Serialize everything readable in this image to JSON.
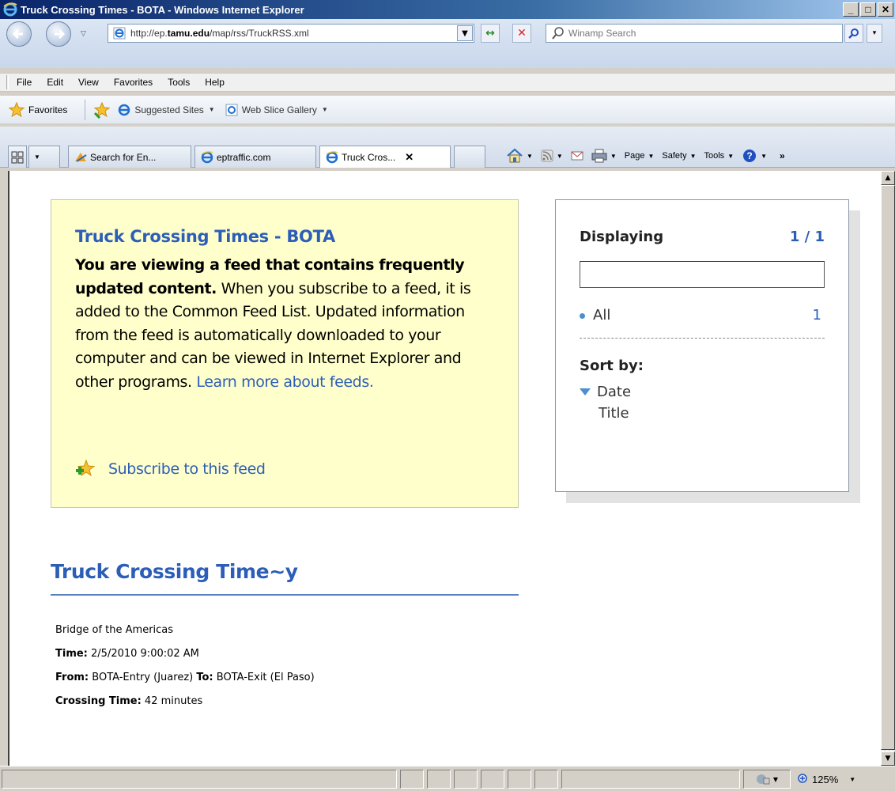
{
  "window": {
    "title": "Truck Crossing Times - BOTA - Windows Internet Explorer"
  },
  "address": {
    "url_prefix": "http://ep.",
    "url_domain": "tamu.edu",
    "url_suffix": "/map/rss/TruckRSS.xml"
  },
  "search": {
    "placeholder": "Winamp Search"
  },
  "menu": {
    "items": [
      "File",
      "Edit",
      "View",
      "Favorites",
      "Tools",
      "Help"
    ]
  },
  "favorites_bar": {
    "favorites": "Favorites",
    "suggested": "Suggested Sites",
    "webslice": "Web Slice Gallery"
  },
  "tabs": [
    {
      "label": "Search for En..."
    },
    {
      "label": "eptraffic.com"
    },
    {
      "label": "Truck Cros..."
    }
  ],
  "commands": {
    "page": "Page",
    "safety": "Safety",
    "tools": "Tools"
  },
  "infobox": {
    "title": "Truck Crossing Times - BOTA",
    "bold_text": "You are viewing a feed that contains frequently updated content.",
    "body_text": " When you subscribe to a feed, it is added to the Common Feed List. Updated information from the feed is automatically downloaded to your computer and can be viewed in Internet Explorer and other programs. ",
    "learn_more": "Learn more about feeds.",
    "subscribe": "Subscribe to this feed"
  },
  "sidepanel": {
    "displaying": "Displaying",
    "count": "1 / 1",
    "all_label": "All",
    "all_count": "1",
    "sort_by": "Sort by:",
    "sort_date": "Date",
    "sort_title": "Title"
  },
  "feed": {
    "title": "Truck Crossing Time~y",
    "bridge": "Bridge of the Americas",
    "time_label": "Time:",
    "time_value": " 2/5/2010 9:00:02 AM",
    "from_label": "From:",
    "from_value": " BOTA-Entry (Juarez) ",
    "to_label": "To:",
    "to_value": " BOTA-Exit (El Paso)",
    "crossing_label": "Crossing Time:",
    "crossing_value": " 42 minutes"
  },
  "status": {
    "zoom": "125%"
  },
  "colors": {
    "link": "#2c5eb8",
    "infobox_bg": "#ffffcc",
    "titlebar": "#0a246a"
  }
}
